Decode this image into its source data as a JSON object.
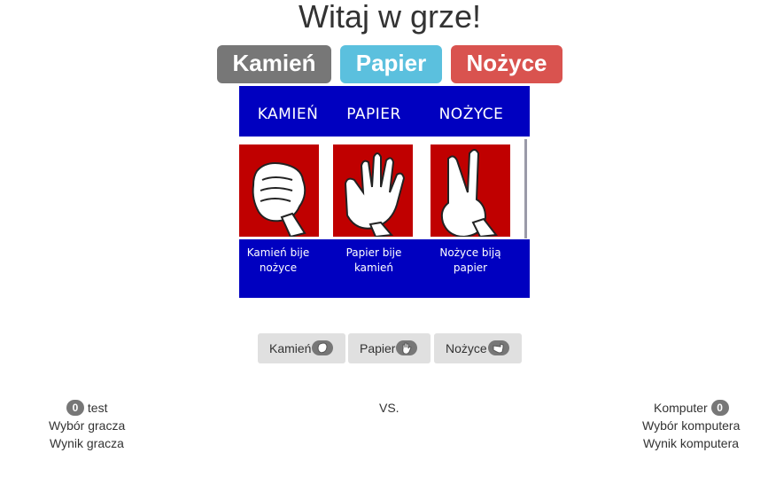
{
  "title": "Witaj w grze!",
  "top_buttons": {
    "rock": "Kamień",
    "paper": "Papier",
    "scissors": "Nożyce"
  },
  "info_image": {
    "columns": [
      "KAMIEŃ",
      "PAPIER",
      "NOŻYCE"
    ],
    "captions": [
      [
        "Kamień bije",
        "nożyce"
      ],
      [
        "Papier bije",
        "kamień"
      ],
      [
        "Nożyce biją",
        "papier"
      ]
    ],
    "colors": {
      "background": "#0000c0",
      "hand_box": "#c00000"
    },
    "icons": [
      "fist-icon",
      "open-hand-icon",
      "peace-sign-icon"
    ]
  },
  "choices": {
    "rock": "Kamień",
    "paper": "Papier",
    "scissors": "Nożyce",
    "icons": [
      "rock-hand-icon",
      "paper-hand-icon",
      "scissors-hand-icon"
    ]
  },
  "player": {
    "score": "0",
    "name": "test",
    "choice_label": "Wybór gracza",
    "result_label": "Wynik gracza"
  },
  "vs": "VS.",
  "computer": {
    "score": "0",
    "name": "Komputer",
    "choice_label": "Wybór komputera",
    "result_label": "Wynik komputera"
  },
  "colors": {
    "gray": "#777777",
    "info": "#5bc0de",
    "danger": "#d9534f",
    "choice_bg": "#e0e0e0"
  }
}
